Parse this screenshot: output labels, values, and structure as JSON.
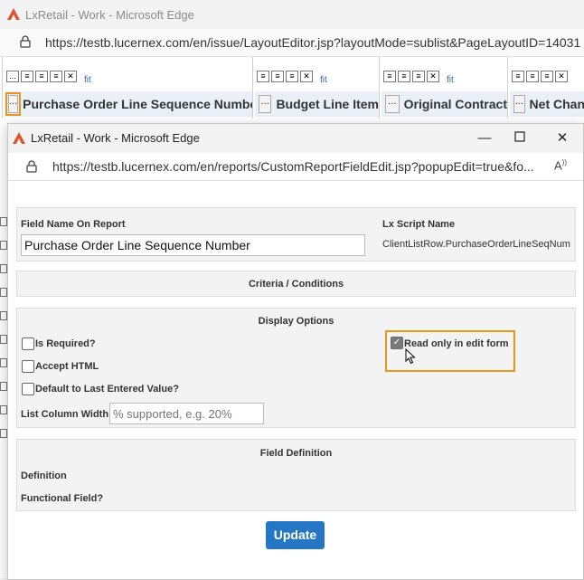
{
  "back_window": {
    "title": "LxRetail - Work - Microsoft Edge",
    "url": "https://testb.lucernex.com/en/issue/LayoutEditor.jsp?layoutMode=sublist&PageLayoutID=14031",
    "fit_label": "fit",
    "more_label": "...",
    "columns": [
      {
        "label": "Purchase Order Line Sequence Number"
      },
      {
        "label": "Budget Line Item"
      },
      {
        "label": "Original Contract"
      },
      {
        "label": "Net Chan"
      }
    ]
  },
  "popup": {
    "title": "LxRetail - Work - Microsoft Edge",
    "url": "https://testb.lucernex.com/en/reports/CustomReportFieldEdit.jsp?popupEdit=true&fo...",
    "field_name_label": "Field Name On Report",
    "field_name_value": "Purchase Order Line Sequence Number",
    "lx_script_label": "Lx Script Name",
    "lx_script_value": "ClientListRow.PurchaseOrderLineSeqNum",
    "criteria_heading": "Criteria / Conditions",
    "display_heading": "Display Options",
    "is_required_label": "Is Required?",
    "accept_html_label": "Accept HTML",
    "default_last_label": "Default to Last Entered Value?",
    "list_width_label": "List Column Width",
    "list_width_placeholder": "% supported, e.g. 20%",
    "read_only_label": "Read only in edit form",
    "read_only_checked": true,
    "field_def_heading": "Field Definition",
    "definition_label": "Definition",
    "functional_label": "Functional Field?",
    "update_label": "Update"
  },
  "colors": {
    "accent": "#2577c6",
    "highlight": "#e8961e",
    "logo": "#e0532b"
  }
}
